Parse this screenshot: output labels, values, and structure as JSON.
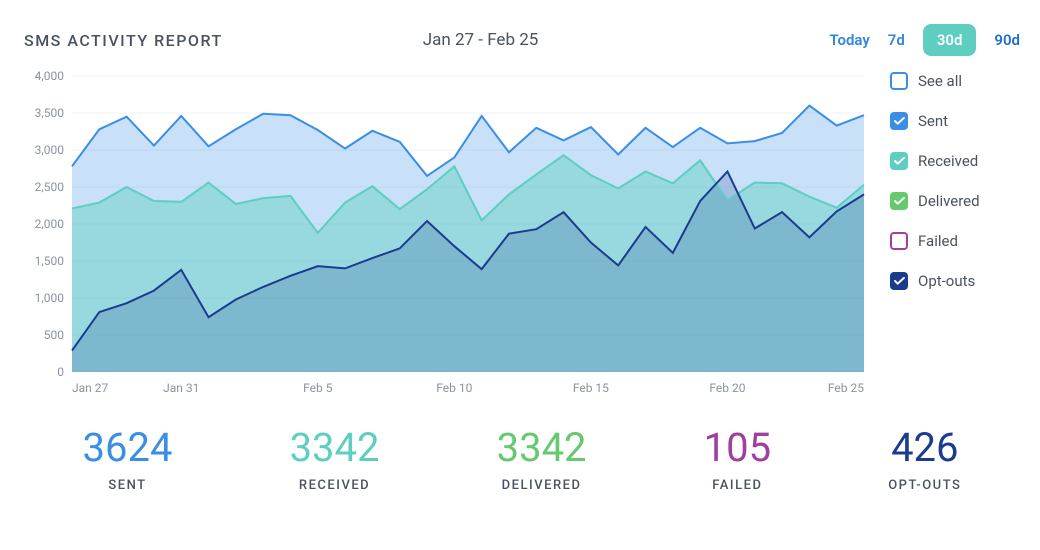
{
  "header": {
    "title": "SMS ACTIVITY REPORT",
    "date_range": "Jan 27 - Feb 25"
  },
  "range_buttons": [
    {
      "label": "Today",
      "active": false
    },
    {
      "label": "7d",
      "active": false
    },
    {
      "label": "30d",
      "active": true
    },
    {
      "label": "90d",
      "active": false
    }
  ],
  "legend": [
    {
      "key": "seeall",
      "label": "See all",
      "color": "#3a8ee6",
      "checked": false,
      "style": "outline"
    },
    {
      "key": "sent",
      "label": "Sent",
      "color": "#3a8ee6",
      "checked": true,
      "style": "filled"
    },
    {
      "key": "received",
      "label": "Received",
      "color": "#5dcec0",
      "checked": true,
      "style": "filled"
    },
    {
      "key": "delivered",
      "label": "Delivered",
      "color": "#67c96d",
      "checked": true,
      "style": "filled"
    },
    {
      "key": "failed",
      "label": "Failed",
      "color": "#a13f9e",
      "checked": false,
      "style": "outline"
    },
    {
      "key": "optout",
      "label": "Opt-outs",
      "color": "#1b3c8e",
      "checked": true,
      "style": "filled"
    }
  ],
  "summary": [
    {
      "value": "3624",
      "label": "SENT",
      "color": "#3a8ee6"
    },
    {
      "value": "3342",
      "label": "RECEIVED",
      "color": "#5dcec0"
    },
    {
      "value": "3342",
      "label": "DELIVERED",
      "color": "#67c96d"
    },
    {
      "value": "105",
      "label": "FAILED",
      "color": "#a13f9e"
    },
    {
      "value": "426",
      "label": "OPT-OUTS",
      "color": "#1b3c8e"
    }
  ],
  "chart_data": {
    "type": "area",
    "title": "SMS ACTIVITY REPORT",
    "xlabel": "",
    "ylabel": "",
    "ylim": [
      0,
      4000
    ],
    "y_ticks": [
      "0",
      "500",
      "1,000",
      "1,500",
      "2,000",
      "2,500",
      "3,000",
      "3,500",
      "4,000"
    ],
    "x_ticks": [
      "Jan 27",
      "Jan 31",
      "Feb 5",
      "Feb 10",
      "Feb 15",
      "Feb 20",
      "Feb 25"
    ],
    "x_tick_indices": [
      0,
      4,
      9,
      14,
      19,
      24,
      29
    ],
    "x": [
      "Jan 27",
      "Jan 28",
      "Jan 29",
      "Jan 30",
      "Jan 31",
      "Feb 1",
      "Feb 2",
      "Feb 3",
      "Feb 4",
      "Feb 5",
      "Feb 6",
      "Feb 7",
      "Feb 8",
      "Feb 9",
      "Feb 10",
      "Feb 11",
      "Feb 12",
      "Feb 13",
      "Feb 14",
      "Feb 15",
      "Feb 16",
      "Feb 17",
      "Feb 18",
      "Feb 19",
      "Feb 20",
      "Feb 21",
      "Feb 22",
      "Feb 23",
      "Feb 24",
      "Feb 25"
    ],
    "series": [
      {
        "name": "Sent",
        "color": "#3a8ee6",
        "fill": "rgba(58,142,230,0.28)",
        "values": [
          2780,
          3280,
          3450,
          3060,
          3460,
          3050,
          3280,
          3490,
          3470,
          3270,
          3020,
          3260,
          3110,
          2650,
          2900,
          3460,
          2970,
          3300,
          3130,
          3310,
          2940,
          3300,
          3040,
          3300,
          3090,
          3120,
          3230,
          3600,
          3330,
          3470
        ]
      },
      {
        "name": "Received",
        "color": "#5dcec0",
        "fill": "rgba(93,206,192,0.45)",
        "values": [
          2210,
          2290,
          2500,
          2310,
          2300,
          2560,
          2270,
          2350,
          2380,
          1880,
          2290,
          2510,
          2200,
          2470,
          2780,
          2050,
          2400,
          2670,
          2930,
          2660,
          2480,
          2710,
          2550,
          2860,
          2320,
          2560,
          2550,
          2370,
          2220,
          2530
        ]
      },
      {
        "name": "Opt-outs",
        "color": "#1b3c8e",
        "fill": "rgba(27,60,142,0.20)",
        "values": [
          290,
          810,
          930,
          1100,
          1380,
          740,
          980,
          1150,
          1300,
          1430,
          1400,
          1540,
          1670,
          2040,
          1700,
          1390,
          1870,
          1930,
          2160,
          1750,
          1440,
          1960,
          1610,
          2310,
          2710,
          1940,
          2160,
          1820,
          2170,
          2400
        ]
      }
    ]
  }
}
